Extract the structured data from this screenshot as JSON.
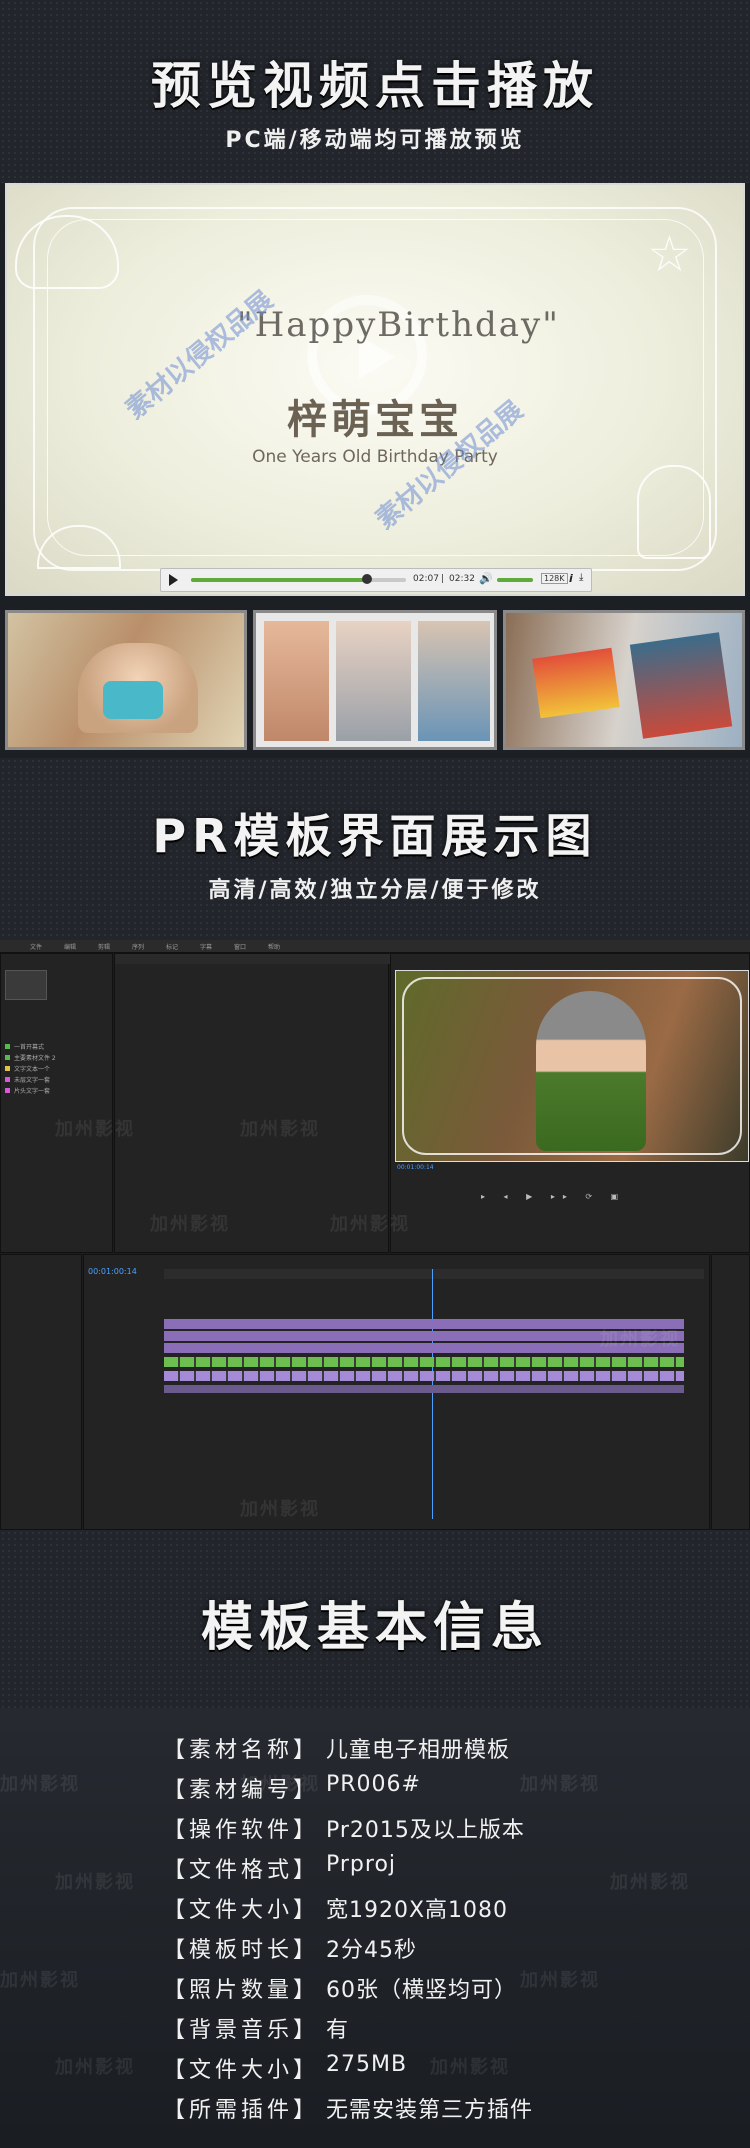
{
  "section1": {
    "title": "预览视频点击播放",
    "subtitle": "PC端/移动端均可播放预览"
  },
  "video": {
    "happy_birthday": "\"HappyBirthday\"",
    "name": "梓萌宝宝",
    "party": "One Years Old Birthday Party",
    "watermark": "素材以侵权品展",
    "time_current": "02:07",
    "time_total": "02:32",
    "quality": "128K",
    "progress": 0.82
  },
  "section2": {
    "title": "PR模板界面展示图",
    "subtitle": "高清/高效/独立分层/便于修改"
  },
  "pr_ui": {
    "timecode": "00:01:00:14",
    "preview_timecode": "00:01:00:14",
    "menu": [
      "文件",
      "编辑",
      "剪辑",
      "序列",
      "标记",
      "字幕",
      "窗口",
      "帮助"
    ],
    "project_items": [
      "一首开幕式",
      "主要素材文件 2",
      "文字文本一个",
      "未层文字一套",
      "片头文字一套"
    ],
    "watermark": "加州影视"
  },
  "section3": {
    "title": "模板基本信息"
  },
  "info": [
    {
      "key": "【素材名称】",
      "value": "儿童电子相册模板"
    },
    {
      "key": "【素材编号】",
      "value": "PR006#"
    },
    {
      "key": "【操作软件】",
      "value": "Pr2015及以上版本"
    },
    {
      "key": "【文件格式】",
      "value": "Prproj"
    },
    {
      "key": "【文件大小】",
      "value": "宽1920X高1080"
    },
    {
      "key": "【模板时长】",
      "value": "2分45秒"
    },
    {
      "key": "【照片数量】",
      "value": "60张（横竖均可）"
    },
    {
      "key": "【背景音乐】",
      "value": "有"
    },
    {
      "key": "【文件大小】",
      "value": "275MB"
    },
    {
      "key": "【所需插件】",
      "value": "无需安装第三方插件"
    }
  ],
  "watermark": "加州影视"
}
